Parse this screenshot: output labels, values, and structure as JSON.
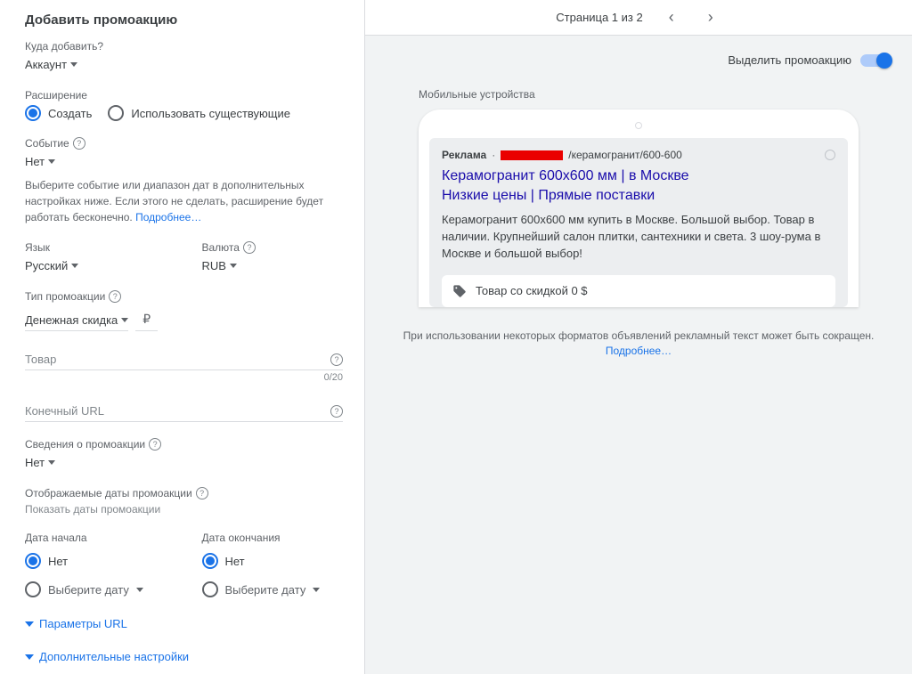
{
  "panel": {
    "title": "Добавить промоакцию",
    "where_label": "Куда добавить?",
    "where_value": "Аккаунт",
    "extension_label": "Расширение",
    "radio_create": "Создать",
    "radio_existing": "Использовать существующие",
    "event_label": "Событие",
    "event_value": "Нет",
    "event_hint": "Выберите событие или диапазон дат в дополнительных настройках ниже. Если этого не сделать, расширение будет работать бесконечно.",
    "learn_more": "Подробнее…",
    "language_label": "Язык",
    "language_value": "Русский",
    "currency_label": "Валюта",
    "currency_value": "RUB",
    "promo_type_label": "Тип промоакции",
    "promo_type_value": "Денежная скидка",
    "currency_symbol": "₽",
    "product_label": "Товар",
    "product_count": "0/20",
    "final_url_label": "Конечный URL",
    "promo_info_label": "Сведения о промоакции",
    "promo_info_value": "Нет",
    "dates_label": "Отображаемые даты промоакции",
    "dates_hint": "Показать даты промоакции",
    "start_label": "Дата начала",
    "end_label": "Дата окончания",
    "date_none": "Нет",
    "date_pick": "Выберите дату",
    "expand_url": "Параметры URL",
    "expand_extra": "Дополнительные настройки"
  },
  "preview": {
    "pager": "Страница 1 из 2",
    "highlight_label": "Выделить промоакцию",
    "device_label": "Мобильные устройства",
    "ad_badge": "Реклама",
    "ad_url_tail": "/керамогранит/600-600",
    "ad_title_l1": "Керамогранит 600х600 мм | в Москве",
    "ad_title_l2": "Низкие цены | Прямые поставки",
    "ad_desc": "Керамогранит 600х600 мм купить в Москве. Большой выбор. Товар в наличии. Крупнейший салон плитки, сантехники и света. 3 шоу-рума в Москве и большой выбор!",
    "promo_text": "Товар со скидкой 0 $",
    "disclaimer": "При использовании некоторых форматов объявлений рекламный текст может быть сокращен.",
    "disclaimer_link": "Подробнее…"
  }
}
